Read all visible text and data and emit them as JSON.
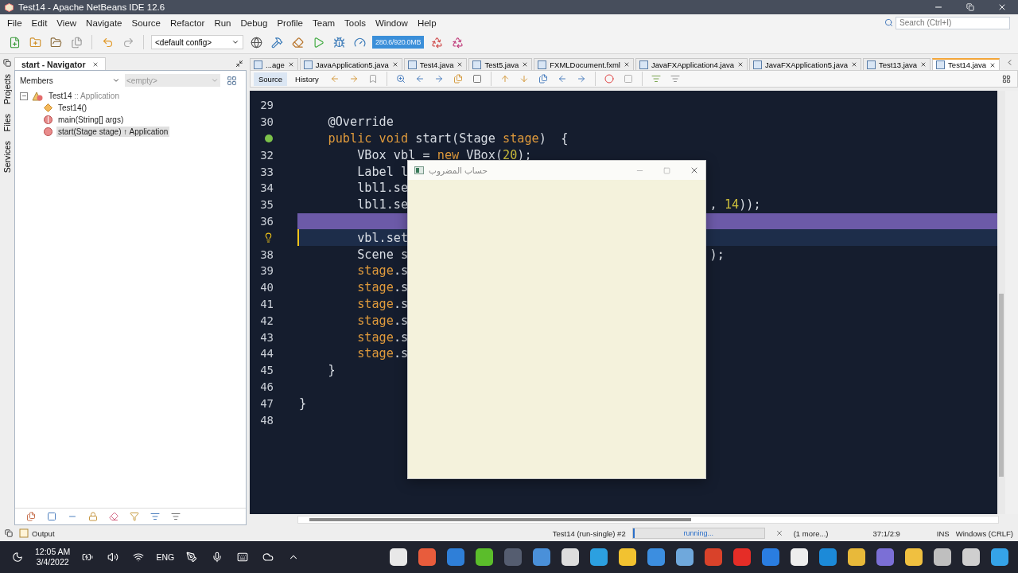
{
  "window": {
    "title": "Test14 - Apache NetBeans IDE 12.6"
  },
  "menu": [
    "File",
    "Edit",
    "View",
    "Navigate",
    "Source",
    "Refactor",
    "Run",
    "Debug",
    "Profile",
    "Team",
    "Tools",
    "Window",
    "Help"
  ],
  "toolbar": {
    "config": "<default config>",
    "memory": "280.6/920.0MB"
  },
  "search": {
    "placeholder": "Search (Ctrl+I)"
  },
  "side_tabs": [
    "Projects",
    "Files",
    "Services"
  ],
  "navigator": {
    "title": "start - Navigator",
    "filter": "Members",
    "scope": "<empty>",
    "tree": {
      "label": "Test14",
      "detail": ":: Application",
      "expanded": true,
      "children": [
        {
          "kind": "constructor",
          "label": "Test14()",
          "selected": false
        },
        {
          "kind": "static",
          "label": "main(String[] args)",
          "selected": false
        },
        {
          "kind": "method",
          "label": "start(Stage stage) ↑ Application",
          "selected": true
        }
      ]
    }
  },
  "editor_tabs": [
    {
      "label": "...age",
      "selected": false
    },
    {
      "label": "JavaApplication5.java",
      "selected": false
    },
    {
      "label": "Test4.java",
      "selected": false
    },
    {
      "label": "Test5.java",
      "selected": false
    },
    {
      "label": "FXMLDocument.fxml",
      "selected": false
    },
    {
      "label": "JavaFXApplication4.java",
      "selected": false
    },
    {
      "label": "JavaFXApplication5.java",
      "selected": false
    },
    {
      "label": "Test13.java",
      "selected": false
    },
    {
      "label": "Test14.java",
      "selected": true
    }
  ],
  "editor_views": [
    {
      "label": "Source",
      "selected": true
    },
    {
      "label": "History",
      "selected": false
    }
  ],
  "code": [
    {
      "number": "29",
      "kind": "plain"
    },
    {
      "number": "30",
      "kind": "plain",
      "tokens": [
        {
          "text": "    @Override",
          "kind": "plain"
        }
      ]
    },
    {
      "gutter": {
        "kind": "override"
      },
      "kind": "plain",
      "tokens": [
        {
          "text": "    public void",
          "kind": "keyword"
        },
        {
          "text": " start(Stage ",
          "kind": "plain"
        },
        {
          "text": "stage",
          "kind": "keyword"
        },
        {
          "text": ")  {",
          "kind": "plain"
        }
      ]
    },
    {
      "number": "32",
      "kind": "plain",
      "tokens": [
        {
          "text": "        VBox vbl = ",
          "kind": "plain"
        },
        {
          "text": "new",
          "kind": "keyword"
        },
        {
          "text": " VBox(",
          "kind": "plain"
        },
        {
          "text": "20",
          "kind": "number"
        },
        {
          "text": ");",
          "kind": "plain"
        }
      ]
    },
    {
      "number": "33",
      "kind": "plain",
      "tokens": [
        {
          "text": "        Label l",
          "kind": "plain"
        }
      ]
    },
    {
      "number": "34",
      "kind": "plain",
      "tokens": [
        {
          "text": "        lbl1.se",
          "kind": "plain"
        }
      ]
    },
    {
      "number": "35",
      "kind": "plain",
      "tokens": [
        {
          "text": "        lbl1.se",
          "kind": "plain"
        }
      ],
      "right": [
        {
          "text": ", ",
          "kind": "plain"
        },
        {
          "text": "14",
          "kind": "number"
        },
        {
          "text": "));",
          "kind": "plain"
        }
      ]
    },
    {
      "number": "36",
      "kind": "marked"
    },
    {
      "gutter": {
        "kind": "hint"
      },
      "kind": "current",
      "tokens": [
        {
          "text": "        vbl.set",
          "kind": "plain"
        }
      ]
    },
    {
      "number": "38",
      "kind": "plain",
      "tokens": [
        {
          "text": "        Scene s",
          "kind": "plain"
        }
      ],
      "right": [
        {
          "text": ");",
          "kind": "plain"
        }
      ]
    },
    {
      "number": "39",
      "kind": "plain",
      "tokens": [
        {
          "text": "        stage",
          "kind": "keyword"
        },
        {
          "text": ".s",
          "kind": "plain"
        }
      ]
    },
    {
      "number": "40",
      "kind": "plain",
      "tokens": [
        {
          "text": "        stage",
          "kind": "keyword"
        },
        {
          "text": ".s",
          "kind": "plain"
        }
      ]
    },
    {
      "number": "41",
      "kind": "plain",
      "tokens": [
        {
          "text": "        stage",
          "kind": "keyword"
        },
        {
          "text": ".s",
          "kind": "plain"
        }
      ]
    },
    {
      "number": "42",
      "kind": "plain",
      "tokens": [
        {
          "text": "        stage",
          "kind": "keyword"
        },
        {
          "text": ".s",
          "kind": "plain"
        }
      ]
    },
    {
      "number": "43",
      "kind": "plain",
      "tokens": [
        {
          "text": "        stage",
          "kind": "keyword"
        },
        {
          "text": ".s",
          "kind": "plain"
        }
      ]
    },
    {
      "number": "44",
      "kind": "plain",
      "tokens": [
        {
          "text": "        stage",
          "kind": "keyword"
        },
        {
          "text": ".s",
          "kind": "plain"
        }
      ]
    },
    {
      "number": "45",
      "kind": "plain",
      "tokens": [
        {
          "text": "    }",
          "kind": "plain"
        }
      ]
    },
    {
      "number": "46",
      "kind": "plain"
    },
    {
      "number": "47",
      "kind": "plain",
      "tokens": [
        {
          "text": "}",
          "kind": "plain"
        }
      ]
    },
    {
      "number": "48",
      "kind": "plain"
    }
  ],
  "popup": {
    "title": "حساب المضروب"
  },
  "output_tab": "Output",
  "status": {
    "task": "Test14 (run-single) #2",
    "progress": {
      "label": "running...",
      "level": 0.01
    },
    "more": "(1 more...)",
    "position": "37:1/2:9",
    "mode": "INS",
    "line_endings": "Windows (CRLF)"
  },
  "taskbar": {
    "time": "12:05 AM",
    "date": "3/4/2022",
    "language": "ENG"
  }
}
